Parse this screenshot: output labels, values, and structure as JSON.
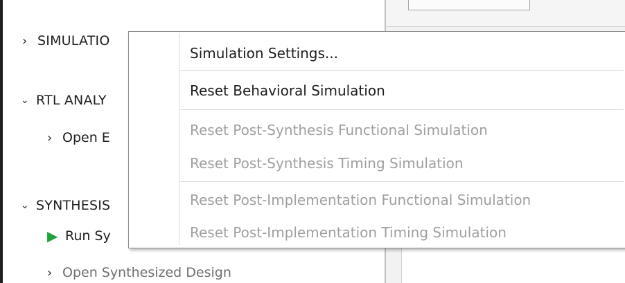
{
  "flow_navigator": {
    "simulation": {
      "label": "SIMULATIO"
    },
    "rtl_analysis": {
      "label": "RTL ANALY",
      "child": "Open E"
    },
    "synthesis": {
      "label": "SYNTHESIS",
      "run_label": "Run Sy",
      "open_label": "Open Synthesized Design"
    }
  },
  "context_menu": {
    "items": [
      {
        "label": "Simulation Settings...",
        "enabled": true
      },
      {
        "label": "Reset Behavioral Simulation",
        "enabled": true
      },
      {
        "label": "Reset Post-Synthesis Functional Simulation",
        "enabled": false
      },
      {
        "label": "Reset Post-Synthesis Timing Simulation",
        "enabled": false
      },
      {
        "label": "Reset Post-Implementation Functional Simulation",
        "enabled": false
      },
      {
        "label": "Reset Post-Implementation Timing Simulation",
        "enabled": false
      }
    ]
  },
  "icons": {
    "collapsed": "chevron-right-icon",
    "expanded": "chevron-down-icon",
    "run": "play-icon"
  },
  "colors": {
    "run_icon": "#21a33b",
    "disabled_text": "#9f9f9f"
  }
}
